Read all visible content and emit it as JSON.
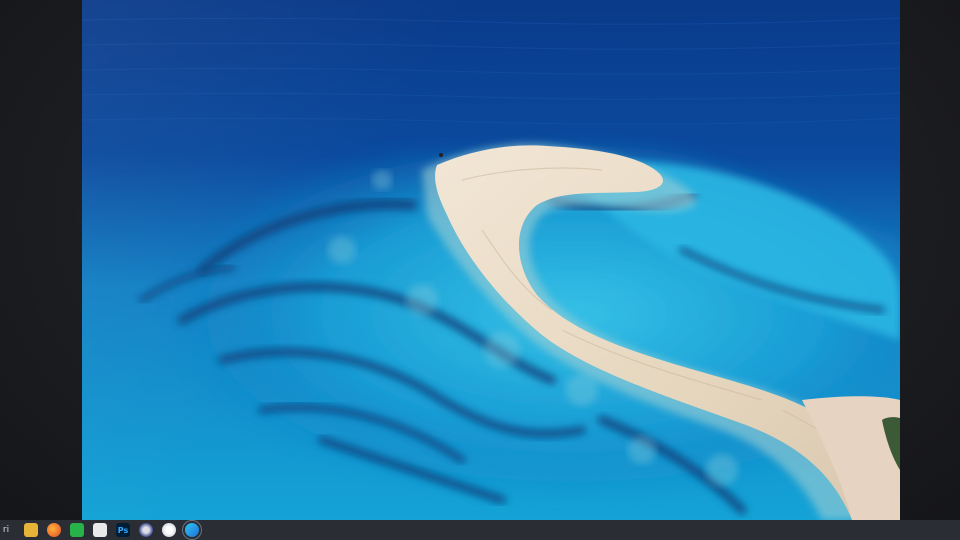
{
  "scene": {
    "description_tokens": [
      "aerial-ocean-sandbar",
      "wallpaper-photo"
    ]
  },
  "taskbar": {
    "start_glyph": "ri",
    "icons": [
      {
        "name": "folder-icon"
      },
      {
        "name": "firefox-icon"
      },
      {
        "name": "phone-icon"
      },
      {
        "name": "notes-icon"
      },
      {
        "name": "photoshop-icon",
        "label": "Ps"
      },
      {
        "name": "app-icon"
      },
      {
        "name": "app-icon-2"
      },
      {
        "name": "edge-icon"
      }
    ]
  },
  "colors": {
    "deep_ocean": "#0a3a8a",
    "shallow_turquoise": "#1aa9d9",
    "sand": "#e8d8c2",
    "reef_dark": "#0b3c78"
  }
}
